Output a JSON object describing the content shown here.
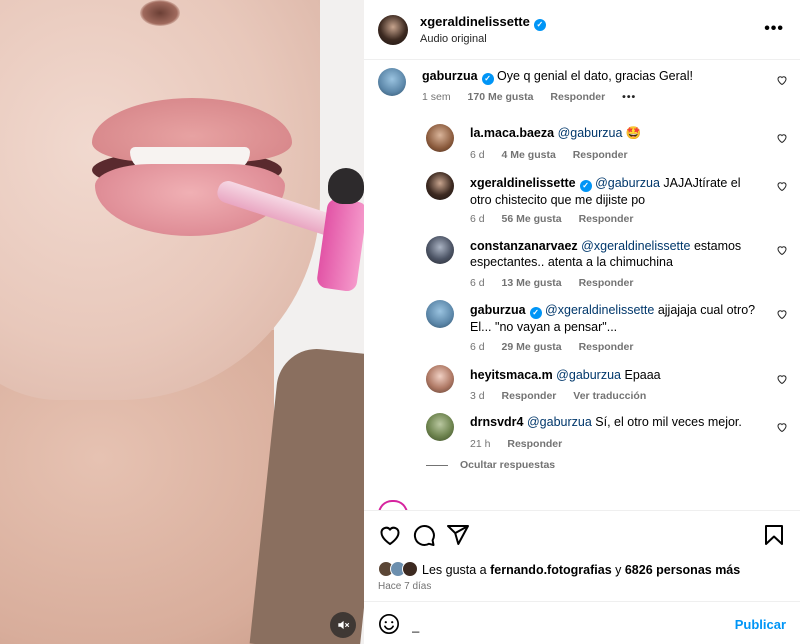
{
  "post": {
    "owner": "xgeraldinelissette",
    "audio": "Audio original",
    "more_label": "•••"
  },
  "comments": [
    {
      "user": "gaburzua",
      "verified": true,
      "mention": "",
      "text": "Oye q genial el dato, gracias Geral!",
      "time": "1 sem",
      "likes": "170 Me gusta",
      "reply": "Responder",
      "extra": "•••"
    },
    {
      "user": "la.maca.baeza",
      "verified": false,
      "mention": "@gaburzua",
      "text": "🤩",
      "time": "6 d",
      "likes": "4 Me gusta",
      "reply": "Responder"
    },
    {
      "user": "xgeraldinelissette",
      "verified": true,
      "mention": "@gaburzua",
      "text": "JAJAJtírate el otro chistecito que me dijiste po",
      "time": "6 d",
      "likes": "56 Me gusta",
      "reply": "Responder"
    },
    {
      "user": "constanzanarvaez",
      "verified": false,
      "mention": "@xgeraldinelissette",
      "text": "estamos espectantes.. atenta a la chimuchina",
      "time": "6 d",
      "likes": "13 Me gusta",
      "reply": "Responder"
    },
    {
      "user": "gaburzua",
      "verified": true,
      "mention": "@xgeraldinelissette",
      "text": "ajjajaja cual otro? El... \"no vayan a pensar\"...",
      "time": "6 d",
      "likes": "29 Me gusta",
      "reply": "Responder"
    },
    {
      "user": "heyitsmaca.m",
      "verified": false,
      "mention": "@gaburzua",
      "text": "Epaaa",
      "time": "3 d",
      "likes": "",
      "reply": "Responder",
      "translate": "Ver traducción"
    },
    {
      "user": "drnsvdr4",
      "verified": false,
      "mention": "@gaburzua",
      "text": "Sí, el otro mil veces mejor.",
      "time": "21 h",
      "likes": "",
      "reply": "Responder"
    }
  ],
  "hide_replies": "Ocultar respuestas",
  "likes": {
    "prefix": "Les gusta a ",
    "user": "fernando.fotografias",
    "middle": " y ",
    "count": "6826 personas más"
  },
  "time_ago": "Hace 7 días",
  "composer": {
    "placeholder": "",
    "value": "_",
    "publish": "Publicar"
  },
  "icons": {
    "like": "heart-icon",
    "comment": "comment-icon",
    "share": "paper-plane-icon",
    "save": "bookmark-icon",
    "emoji": "smiley-icon",
    "mute": "muted-speaker-icon"
  },
  "colors": {
    "accent": "#0095f6",
    "mention": "#00376b",
    "secondary_text": "#737373",
    "verified": "#0095f6"
  }
}
